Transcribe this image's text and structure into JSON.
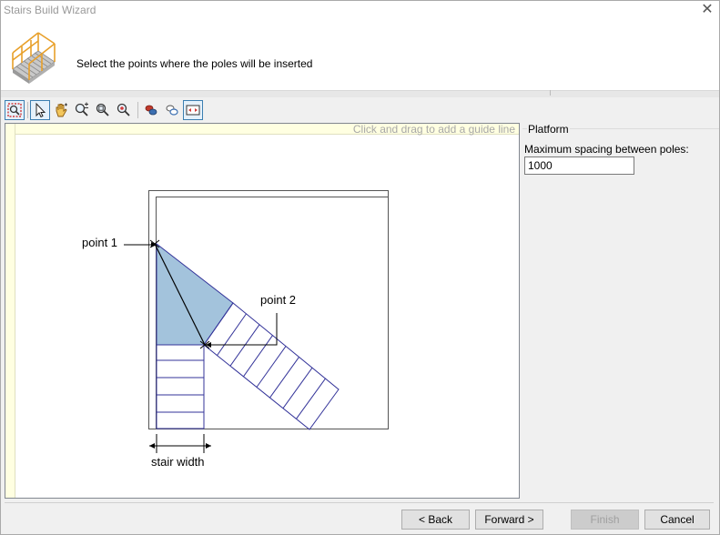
{
  "window": {
    "title": "Stairs Build Wizard"
  },
  "header": {
    "instruction": "Select the points where the poles will be inserted"
  },
  "toolbar": {
    "items": [
      "zoom-region-icon",
      "pointer-icon",
      "pan-hand-icon",
      "zoom-in-out-icon",
      "zoom-window-icon",
      "zoom-extents-icon",
      "add-pole-icon",
      "remove-pole-icon",
      "fit-width-icon"
    ]
  },
  "canvas": {
    "guide_hint": "Click and drag to add a guide line",
    "labels": {
      "point1": "point 1",
      "point2": "point 2",
      "stair_width": "stair width"
    },
    "colors": {
      "landing_fill": "#a3c3dc",
      "stair_line": "#333399"
    }
  },
  "panel": {
    "group_title": "Platform",
    "spacing_label": "Maximum spacing between poles:",
    "spacing_value": "1000"
  },
  "buttons": {
    "back": "< Back",
    "forward": "Forward >",
    "finish": "Finish",
    "cancel": "Cancel"
  }
}
